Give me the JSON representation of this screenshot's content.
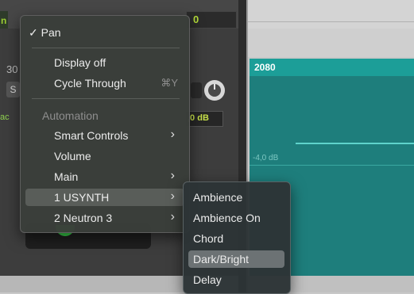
{
  "background": {
    "top_letter": "n",
    "zero_readout": "0",
    "left_value": "30",
    "left_button": "S",
    "left_label": "ac",
    "gain_readout": ",0 dB",
    "region_title": "2080",
    "region_db": "-4,0 dB"
  },
  "menu": {
    "check_item": "✓ Pan",
    "items": [
      {
        "label": "Display off"
      },
      {
        "label": "Cycle Through",
        "shortcut": "⌘Y"
      }
    ],
    "automation_header": "Automation",
    "automation_items": [
      {
        "label": "Smart Controls",
        "chevron": "›"
      },
      {
        "label": "Volume"
      },
      {
        "label": "Main",
        "chevron": "›"
      },
      {
        "label": "1 USYNTH",
        "chevron": "›"
      },
      {
        "label": "2 Neutron 3",
        "chevron": "›"
      }
    ]
  },
  "submenu": {
    "items": [
      "Ambience",
      "Ambience On",
      "Chord",
      "Dark/Bright",
      "Delay"
    ]
  },
  "colors": {
    "region": "#1e7e7c",
    "region_header": "#1c9e98",
    "menu_bg": "#3a3e3a",
    "highlight": "#595d59"
  }
}
